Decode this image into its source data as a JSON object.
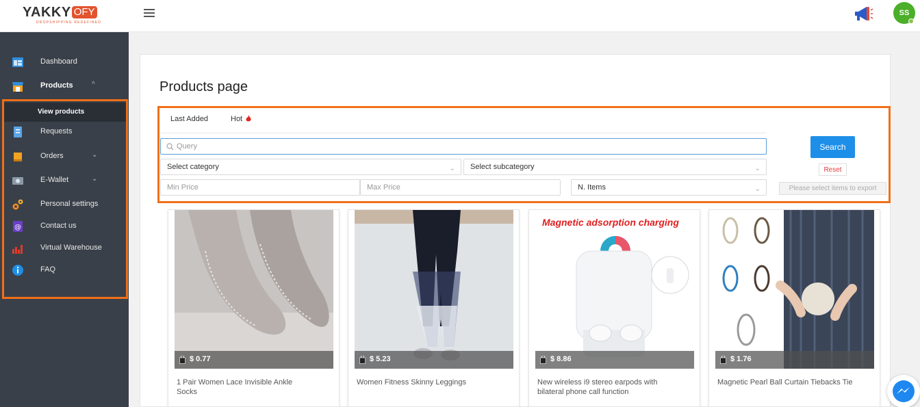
{
  "header": {
    "logo_text": "YAKKY",
    "logo_badge": "OFY",
    "logo_tagline": "DROPSHIPPING REDEFINED",
    "avatar_initials": "SS"
  },
  "sidebar": {
    "items": [
      {
        "label": "Dashboard",
        "icon": "dashboard-icon"
      },
      {
        "label": "Products",
        "icon": "store-icon",
        "chevron": "^"
      },
      {
        "label": "View products"
      },
      {
        "label": "Requests",
        "icon": "requests-icon"
      },
      {
        "label": "Orders",
        "icon": "orders-icon",
        "chevron": "⌄"
      },
      {
        "label": "E-Wallet",
        "icon": "wallet-icon",
        "chevron": "⌄"
      },
      {
        "label": "Personal settings",
        "icon": "gear-icon"
      },
      {
        "label": "Contact us",
        "icon": "at-icon"
      },
      {
        "label": "Virtual Warehouse",
        "icon": "chart-icon"
      },
      {
        "label": "FAQ",
        "icon": "info-icon"
      }
    ]
  },
  "main": {
    "title": "Products page",
    "tabs": [
      "Last Added",
      "Hot"
    ],
    "filters": {
      "query_placeholder": "Query",
      "category_placeholder": "Select category",
      "subcategory_placeholder": "Select subcategory",
      "min_price_placeholder": "Min Price",
      "max_price_placeholder": "Max Price",
      "items_placeholder": "N. Items"
    },
    "buttons": {
      "search": "Search",
      "reset": "Reset",
      "export": "Please select items to export"
    },
    "products": [
      {
        "price": "$ 0.77",
        "name": "1 Pair Women Lace Invisible Ankle Socks"
      },
      {
        "price": "$ 5.23",
        "name": "Women Fitness Skinny Leggings"
      },
      {
        "price": "$ 8.86",
        "name": "New wireless i9 stereo earpods with bilateral phone call function",
        "image_caption": "Magnetic adsorption charging"
      },
      {
        "price": "$ 1.76",
        "name": "Magnetic Pearl Ball Curtain Tiebacks Tie"
      }
    ]
  },
  "colors": {
    "accent": "#1e8fe8",
    "highlight_frame": "#f07018",
    "sidebar_bg": "#3a4049",
    "brand": "#e2532e"
  }
}
